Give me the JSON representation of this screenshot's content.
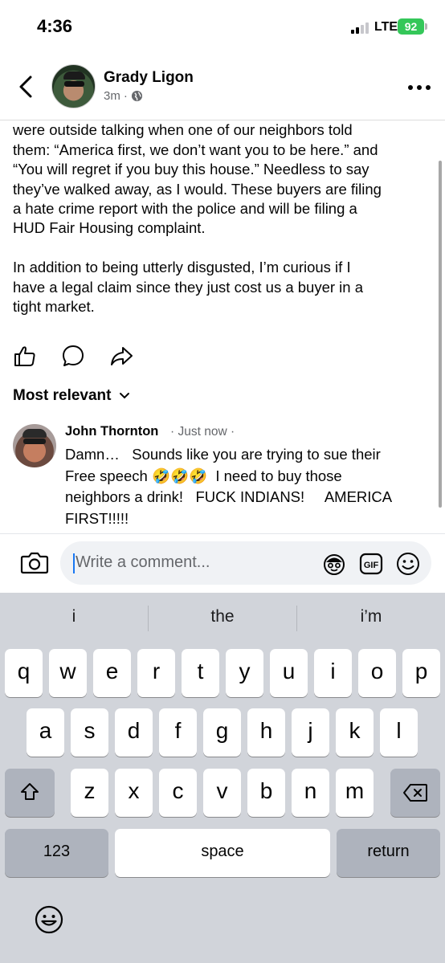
{
  "status_bar": {
    "time": "4:36",
    "network": "LTE",
    "battery": "92"
  },
  "header": {
    "author": "Grady Ligon",
    "timestamp": "3m",
    "separator": "·"
  },
  "post": {
    "body": "agent, they were ready to meet our asking price and\nwere outside talking when one of our neighbors told\nthem: “America first, we don’t want you to be here.” and\n“You will regret if you buy this house.” Needless to say\nthey’ve walked away, as I would. These buyers are filing\na hate crime report with the police and will be filing a\nHUD Fair Housing complaint.\n\nIn addition to being utterly disgusted, I’m curious if I\nhave a legal claim since they just cost us a buyer in a\ntight market."
  },
  "actions": [
    "like-icon",
    "comment-icon",
    "share-icon"
  ],
  "comments_filter": {
    "label": "Most relevant"
  },
  "comment": {
    "author": "John Thornton",
    "time": "· Just now ·",
    "text": "Damn…   Sounds like you are trying to sue their\nFree speech 🤣🤣🤣  I need to buy those\nneighbors a drink!   FUCK INDIANS!     AMERICA\nFIRST!!!!!"
  },
  "comment_bar": {
    "placeholder": "Write a comment..."
  },
  "keyboard": {
    "suggestions": [
      "i",
      "the",
      "i’m"
    ],
    "row1": [
      "q",
      "w",
      "e",
      "r",
      "t",
      "y",
      "u",
      "i",
      "o",
      "p"
    ],
    "row2": [
      "a",
      "s",
      "d",
      "f",
      "g",
      "h",
      "j",
      "k",
      "l"
    ],
    "row3": [
      "z",
      "x",
      "c",
      "v",
      "b",
      "n",
      "m"
    ],
    "numbers_key": "123",
    "space_key": "space",
    "return_key": "return"
  },
  "colors": {
    "accent": "#1877f2",
    "battery": "#34c759",
    "secondary_text": "#65676b",
    "keyboard_bg": "#d1d4da"
  }
}
